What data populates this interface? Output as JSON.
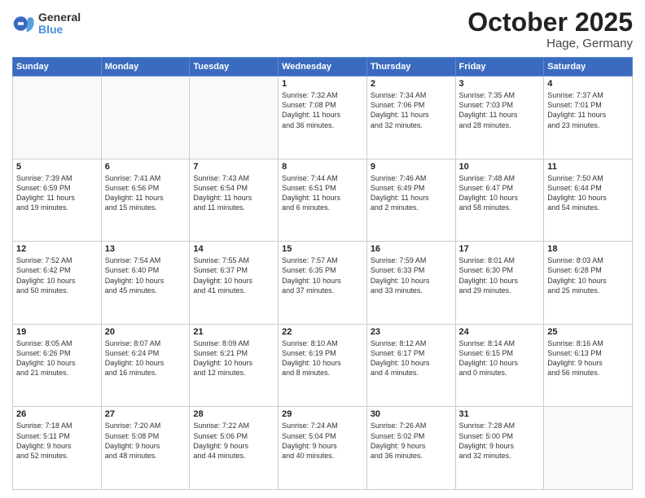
{
  "header": {
    "logo_general": "General",
    "logo_blue": "Blue",
    "month_title": "October 2025",
    "location": "Hage, Germany"
  },
  "days_of_week": [
    "Sunday",
    "Monday",
    "Tuesday",
    "Wednesday",
    "Thursday",
    "Friday",
    "Saturday"
  ],
  "weeks": [
    [
      {
        "day": "",
        "text": ""
      },
      {
        "day": "",
        "text": ""
      },
      {
        "day": "",
        "text": ""
      },
      {
        "day": "1",
        "text": "Sunrise: 7:32 AM\nSunset: 7:08 PM\nDaylight: 11 hours\nand 36 minutes."
      },
      {
        "day": "2",
        "text": "Sunrise: 7:34 AM\nSunset: 7:06 PM\nDaylight: 11 hours\nand 32 minutes."
      },
      {
        "day": "3",
        "text": "Sunrise: 7:35 AM\nSunset: 7:03 PM\nDaylight: 11 hours\nand 28 minutes."
      },
      {
        "day": "4",
        "text": "Sunrise: 7:37 AM\nSunset: 7:01 PM\nDaylight: 11 hours\nand 23 minutes."
      }
    ],
    [
      {
        "day": "5",
        "text": "Sunrise: 7:39 AM\nSunset: 6:59 PM\nDaylight: 11 hours\nand 19 minutes."
      },
      {
        "day": "6",
        "text": "Sunrise: 7:41 AM\nSunset: 6:56 PM\nDaylight: 11 hours\nand 15 minutes."
      },
      {
        "day": "7",
        "text": "Sunrise: 7:43 AM\nSunset: 6:54 PM\nDaylight: 11 hours\nand 11 minutes."
      },
      {
        "day": "8",
        "text": "Sunrise: 7:44 AM\nSunset: 6:51 PM\nDaylight: 11 hours\nand 6 minutes."
      },
      {
        "day": "9",
        "text": "Sunrise: 7:46 AM\nSunset: 6:49 PM\nDaylight: 11 hours\nand 2 minutes."
      },
      {
        "day": "10",
        "text": "Sunrise: 7:48 AM\nSunset: 6:47 PM\nDaylight: 10 hours\nand 58 minutes."
      },
      {
        "day": "11",
        "text": "Sunrise: 7:50 AM\nSunset: 6:44 PM\nDaylight: 10 hours\nand 54 minutes."
      }
    ],
    [
      {
        "day": "12",
        "text": "Sunrise: 7:52 AM\nSunset: 6:42 PM\nDaylight: 10 hours\nand 50 minutes."
      },
      {
        "day": "13",
        "text": "Sunrise: 7:54 AM\nSunset: 6:40 PM\nDaylight: 10 hours\nand 45 minutes."
      },
      {
        "day": "14",
        "text": "Sunrise: 7:55 AM\nSunset: 6:37 PM\nDaylight: 10 hours\nand 41 minutes."
      },
      {
        "day": "15",
        "text": "Sunrise: 7:57 AM\nSunset: 6:35 PM\nDaylight: 10 hours\nand 37 minutes."
      },
      {
        "day": "16",
        "text": "Sunrise: 7:59 AM\nSunset: 6:33 PM\nDaylight: 10 hours\nand 33 minutes."
      },
      {
        "day": "17",
        "text": "Sunrise: 8:01 AM\nSunset: 6:30 PM\nDaylight: 10 hours\nand 29 minutes."
      },
      {
        "day": "18",
        "text": "Sunrise: 8:03 AM\nSunset: 6:28 PM\nDaylight: 10 hours\nand 25 minutes."
      }
    ],
    [
      {
        "day": "19",
        "text": "Sunrise: 8:05 AM\nSunset: 6:26 PM\nDaylight: 10 hours\nand 21 minutes."
      },
      {
        "day": "20",
        "text": "Sunrise: 8:07 AM\nSunset: 6:24 PM\nDaylight: 10 hours\nand 16 minutes."
      },
      {
        "day": "21",
        "text": "Sunrise: 8:09 AM\nSunset: 6:21 PM\nDaylight: 10 hours\nand 12 minutes."
      },
      {
        "day": "22",
        "text": "Sunrise: 8:10 AM\nSunset: 6:19 PM\nDaylight: 10 hours\nand 8 minutes."
      },
      {
        "day": "23",
        "text": "Sunrise: 8:12 AM\nSunset: 6:17 PM\nDaylight: 10 hours\nand 4 minutes."
      },
      {
        "day": "24",
        "text": "Sunrise: 8:14 AM\nSunset: 6:15 PM\nDaylight: 10 hours\nand 0 minutes."
      },
      {
        "day": "25",
        "text": "Sunrise: 8:16 AM\nSunset: 6:13 PM\nDaylight: 9 hours\nand 56 minutes."
      }
    ],
    [
      {
        "day": "26",
        "text": "Sunrise: 7:18 AM\nSunset: 5:11 PM\nDaylight: 9 hours\nand 52 minutes."
      },
      {
        "day": "27",
        "text": "Sunrise: 7:20 AM\nSunset: 5:08 PM\nDaylight: 9 hours\nand 48 minutes."
      },
      {
        "day": "28",
        "text": "Sunrise: 7:22 AM\nSunset: 5:06 PM\nDaylight: 9 hours\nand 44 minutes."
      },
      {
        "day": "29",
        "text": "Sunrise: 7:24 AM\nSunset: 5:04 PM\nDaylight: 9 hours\nand 40 minutes."
      },
      {
        "day": "30",
        "text": "Sunrise: 7:26 AM\nSunset: 5:02 PM\nDaylight: 9 hours\nand 36 minutes."
      },
      {
        "day": "31",
        "text": "Sunrise: 7:28 AM\nSunset: 5:00 PM\nDaylight: 9 hours\nand 32 minutes."
      },
      {
        "day": "",
        "text": ""
      }
    ]
  ]
}
